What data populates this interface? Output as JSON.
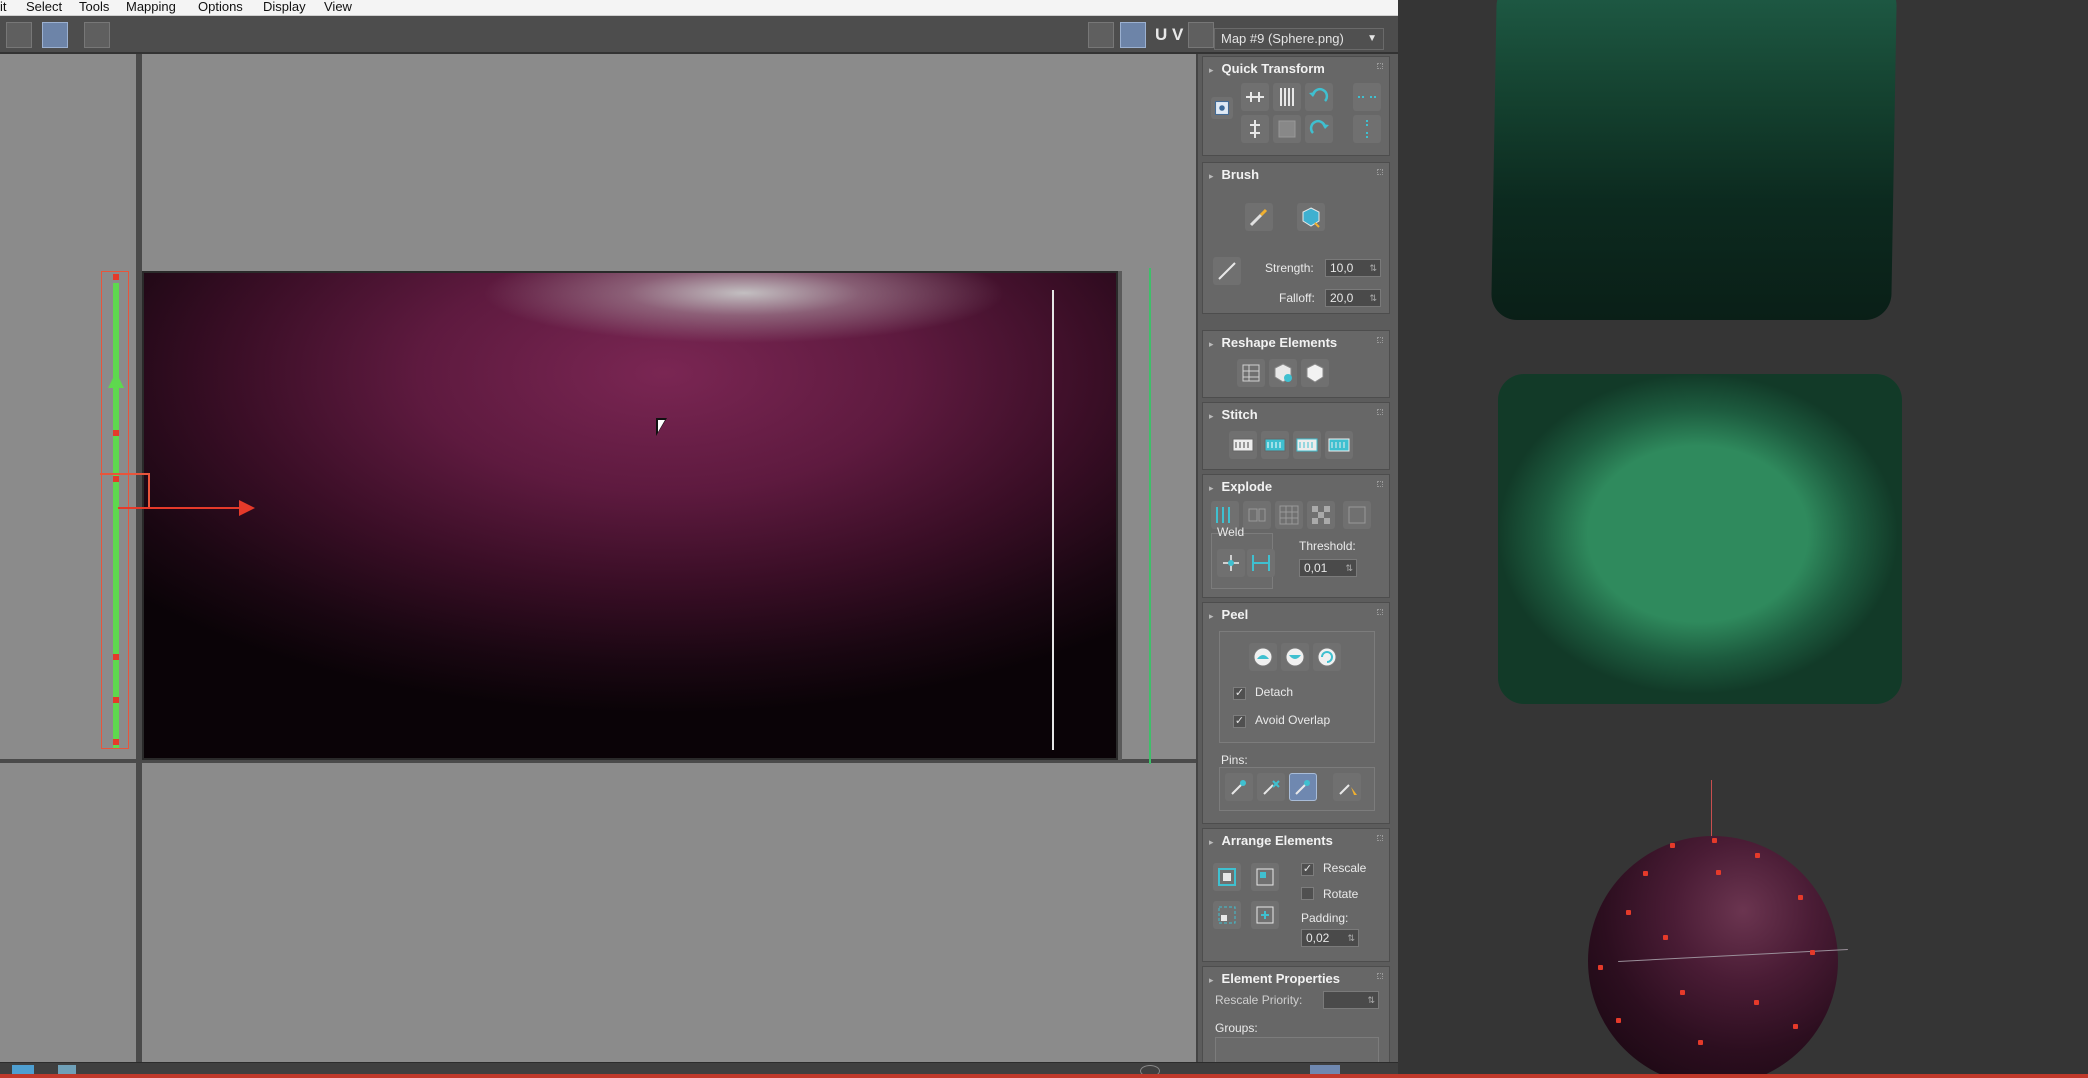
{
  "menu": {
    "items": [
      {
        "label": "it"
      },
      {
        "label": "Select"
      },
      {
        "label": "Tools"
      },
      {
        "label": "Mapping"
      },
      {
        "label": "Options"
      },
      {
        "label": "Display"
      },
      {
        "label": "View"
      }
    ]
  },
  "toolbar": {
    "uv_label": "U V",
    "map_select": "Map #9 (Sphere.png)"
  },
  "panel": {
    "quick_transform": {
      "title": "Quick Transform"
    },
    "brush": {
      "title": "Brush",
      "strength_label": "Strength:",
      "strength_value": "10,0",
      "falloff_label": "Falloff:",
      "falloff_value": "20,0"
    },
    "reshape": {
      "title": "Reshape Elements"
    },
    "stitch": {
      "title": "Stitch"
    },
    "explode": {
      "title": "Explode",
      "weld_label": "Weld",
      "threshold_label": "Threshold:",
      "threshold_value": "0,01"
    },
    "peel": {
      "title": "Peel",
      "detach_label": "Detach",
      "detach_checked": true,
      "avoid_overlap_label": "Avoid Overlap",
      "avoid_overlap_checked": true,
      "pins_label": "Pins:"
    },
    "arrange": {
      "title": "Arrange Elements",
      "rescale_label": "Rescale",
      "rescale_checked": true,
      "rotate_label": "Rotate",
      "rotate_checked": false,
      "padding_label": "Padding:",
      "padding_value": "0,02"
    },
    "element_props": {
      "title": "Element Properties",
      "rescale_priority_label": "Rescale Priority:",
      "groups_label": "Groups:"
    }
  },
  "colors": {
    "uv_strip": "#5ed84e",
    "gizmo_x": "#e53a2a",
    "texture_tint": "#7a2653",
    "box_green": "#2f8a5d"
  }
}
